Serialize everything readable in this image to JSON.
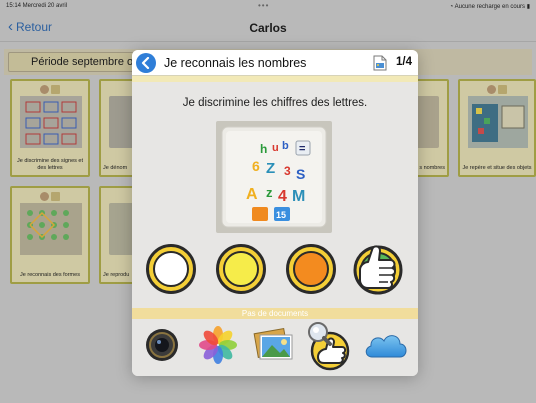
{
  "status": {
    "time_date": "15:14  Mercredi 20 avril",
    "dots": "•••",
    "battery": "Aucune recharge en cours"
  },
  "nav": {
    "back_label": "Retour",
    "title": "Carlos"
  },
  "period": {
    "label": "Période septembre o"
  },
  "background_cards": [
    {
      "label": "Je discrimine des signes et des lettres"
    },
    {
      "label": "Je dénom"
    },
    {
      "label": "s nombres"
    },
    {
      "label": "Je repère et situe des objets"
    },
    {
      "label": "Je reconnais des formes"
    },
    {
      "label": "Je reprodu"
    }
  ],
  "modal": {
    "title": "Je reconnais les nombres",
    "counter": "1/4",
    "instruction": "Je discrimine les chiffres des lettres.",
    "photo_alt": "plateau avec lettres et chiffres",
    "level_circles": [
      {
        "name": "white",
        "color": "#ffffff"
      },
      {
        "name": "yellow",
        "color": "#f6ec4a"
      },
      {
        "name": "orange",
        "color": "#f38b1f"
      }
    ],
    "validation_icon": "thumbs-up-icon",
    "no_documents": "Pas de documents",
    "bottom_icons": [
      "camera-icon",
      "photos-icon",
      "image-gallery-icon",
      "magnifier-thumb-icon",
      "cloud-icon"
    ]
  },
  "colors": {
    "accent_blue": "#2f7ed8",
    "card_border": "#9f9d44",
    "circle_ring": "#f4cf37"
  }
}
